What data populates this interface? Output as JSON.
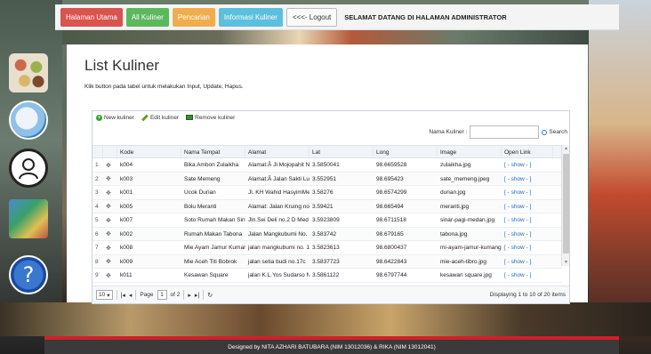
{
  "nav": {
    "items": [
      {
        "label": "Halaman Utama",
        "color": "#d9534f"
      },
      {
        "label": "All Kuliner",
        "color": "#5cb85c"
      },
      {
        "label": "Pencarian",
        "color": "#f0ad4e"
      },
      {
        "label": "Informasi Kuliner",
        "color": "#5bc0de"
      }
    ],
    "logout": "<<<- Logout",
    "welcome": "SELAMAT DATANG DI HALAMAN ADMINISTRATOR"
  },
  "side_icons": [
    "food-collage-icon",
    "map-globe-icon",
    "user-avatar-icon",
    "documents-icon",
    "help-icon"
  ],
  "help_symbol": "?",
  "main": {
    "title": "List Kuliner",
    "description": "Klik button pada tabel untuk melakukan Input, Update, Hapus."
  },
  "toolbar": {
    "new": "New kuliner",
    "edit": "Edit kuliner",
    "remove": "Remove kuliner"
  },
  "search": {
    "label": "Nama Kuliner :",
    "value": "",
    "button": "Search"
  },
  "table": {
    "columns": [
      "Kode",
      "Nama Tempat",
      "Alamat",
      "Lat",
      "Long",
      "Image",
      "Open Link"
    ],
    "rows": [
      {
        "num": "1",
        "kode": "k004",
        "nama": "Bika Ambon Zulaikha",
        "alamat": "Alamat:Â Jl.Mojopahit N",
        "lat": "3.5850041",
        "long": "98.6659528",
        "image": "zulaikha.jpg",
        "link": "[ - show - ]"
      },
      {
        "num": "2",
        "kode": "k003",
        "nama": "Sate Memeng",
        "alamat": "Alamat:Â Jalan Sakti Lu",
        "lat": "3.552951",
        "long": "98.695423",
        "image": "sate_memeng.jpeg",
        "link": "[ - show - ]"
      },
      {
        "num": "3",
        "kode": "k001",
        "nama": "Ucok Durian",
        "alamat": "Jl. KH Wahid HasyimMe",
        "lat": "3.58276",
        "long": "98.6574299",
        "image": "durian.jpg",
        "link": "[ - show - ]"
      },
      {
        "num": "4",
        "kode": "k005",
        "nama": "Bolu Meranti",
        "alamat": "Alamat: Jalan Kruing no",
        "lat": "3.59421",
        "long": "98.665494",
        "image": "meranti.jpg",
        "link": "[ - show - ]"
      },
      {
        "num": "5",
        "kode": "k007",
        "nama": "Soto Rumah Makan Sin",
        "alamat": "Jln.Sei Deli no.2 D Med",
        "lat": "3.5923809",
        "long": "98.6711518",
        "image": "sinar-pagi-medan.jpg",
        "link": "[ - show - ]"
      },
      {
        "num": "6",
        "kode": "k002",
        "nama": "Rumah Makan Tabona",
        "alamat": "Jalan Mangkubumi No.",
        "lat": "3.583742",
        "long": "98.679165",
        "image": "tabona.jpg",
        "link": "[ - show - ]"
      },
      {
        "num": "7",
        "kode": "k008",
        "nama": "Mie Ayam Jamur Kumar",
        "alamat": "jalan mangkubumi no. 1",
        "lat": "3.5823613",
        "long": "98.6800437",
        "image": "mi-ayam-jamur-kumang",
        "link": "[ - show - ]"
      },
      {
        "num": "8",
        "kode": "k009",
        "nama": "Mie Aceh Titi Bobrok",
        "alamat": "jalan setia budi no.17c",
        "lat": "3.5837723",
        "long": "98.6422843",
        "image": "mie-aceh-tibro.jpg",
        "link": "[ - show - ]"
      },
      {
        "num": "9",
        "kode": "k011",
        "nama": "Kesawan Square",
        "alamat": "jalan K.L.Yos Sudarso N",
        "lat": "3.5861122",
        "long": "98.6797744",
        "image": "kesawan square.jpg",
        "link": "[ - show - ]"
      }
    ]
  },
  "pager": {
    "page_size": "10",
    "page_label": "Page",
    "page_value": "1",
    "of_label": "of 2",
    "displaying": "Displaying 1 to 10 of 20 items"
  },
  "footer": {
    "text": "Designed by NITA AZHARI BATUBARA (NIM 13012036) & RIKA (NIM 13012041)"
  }
}
